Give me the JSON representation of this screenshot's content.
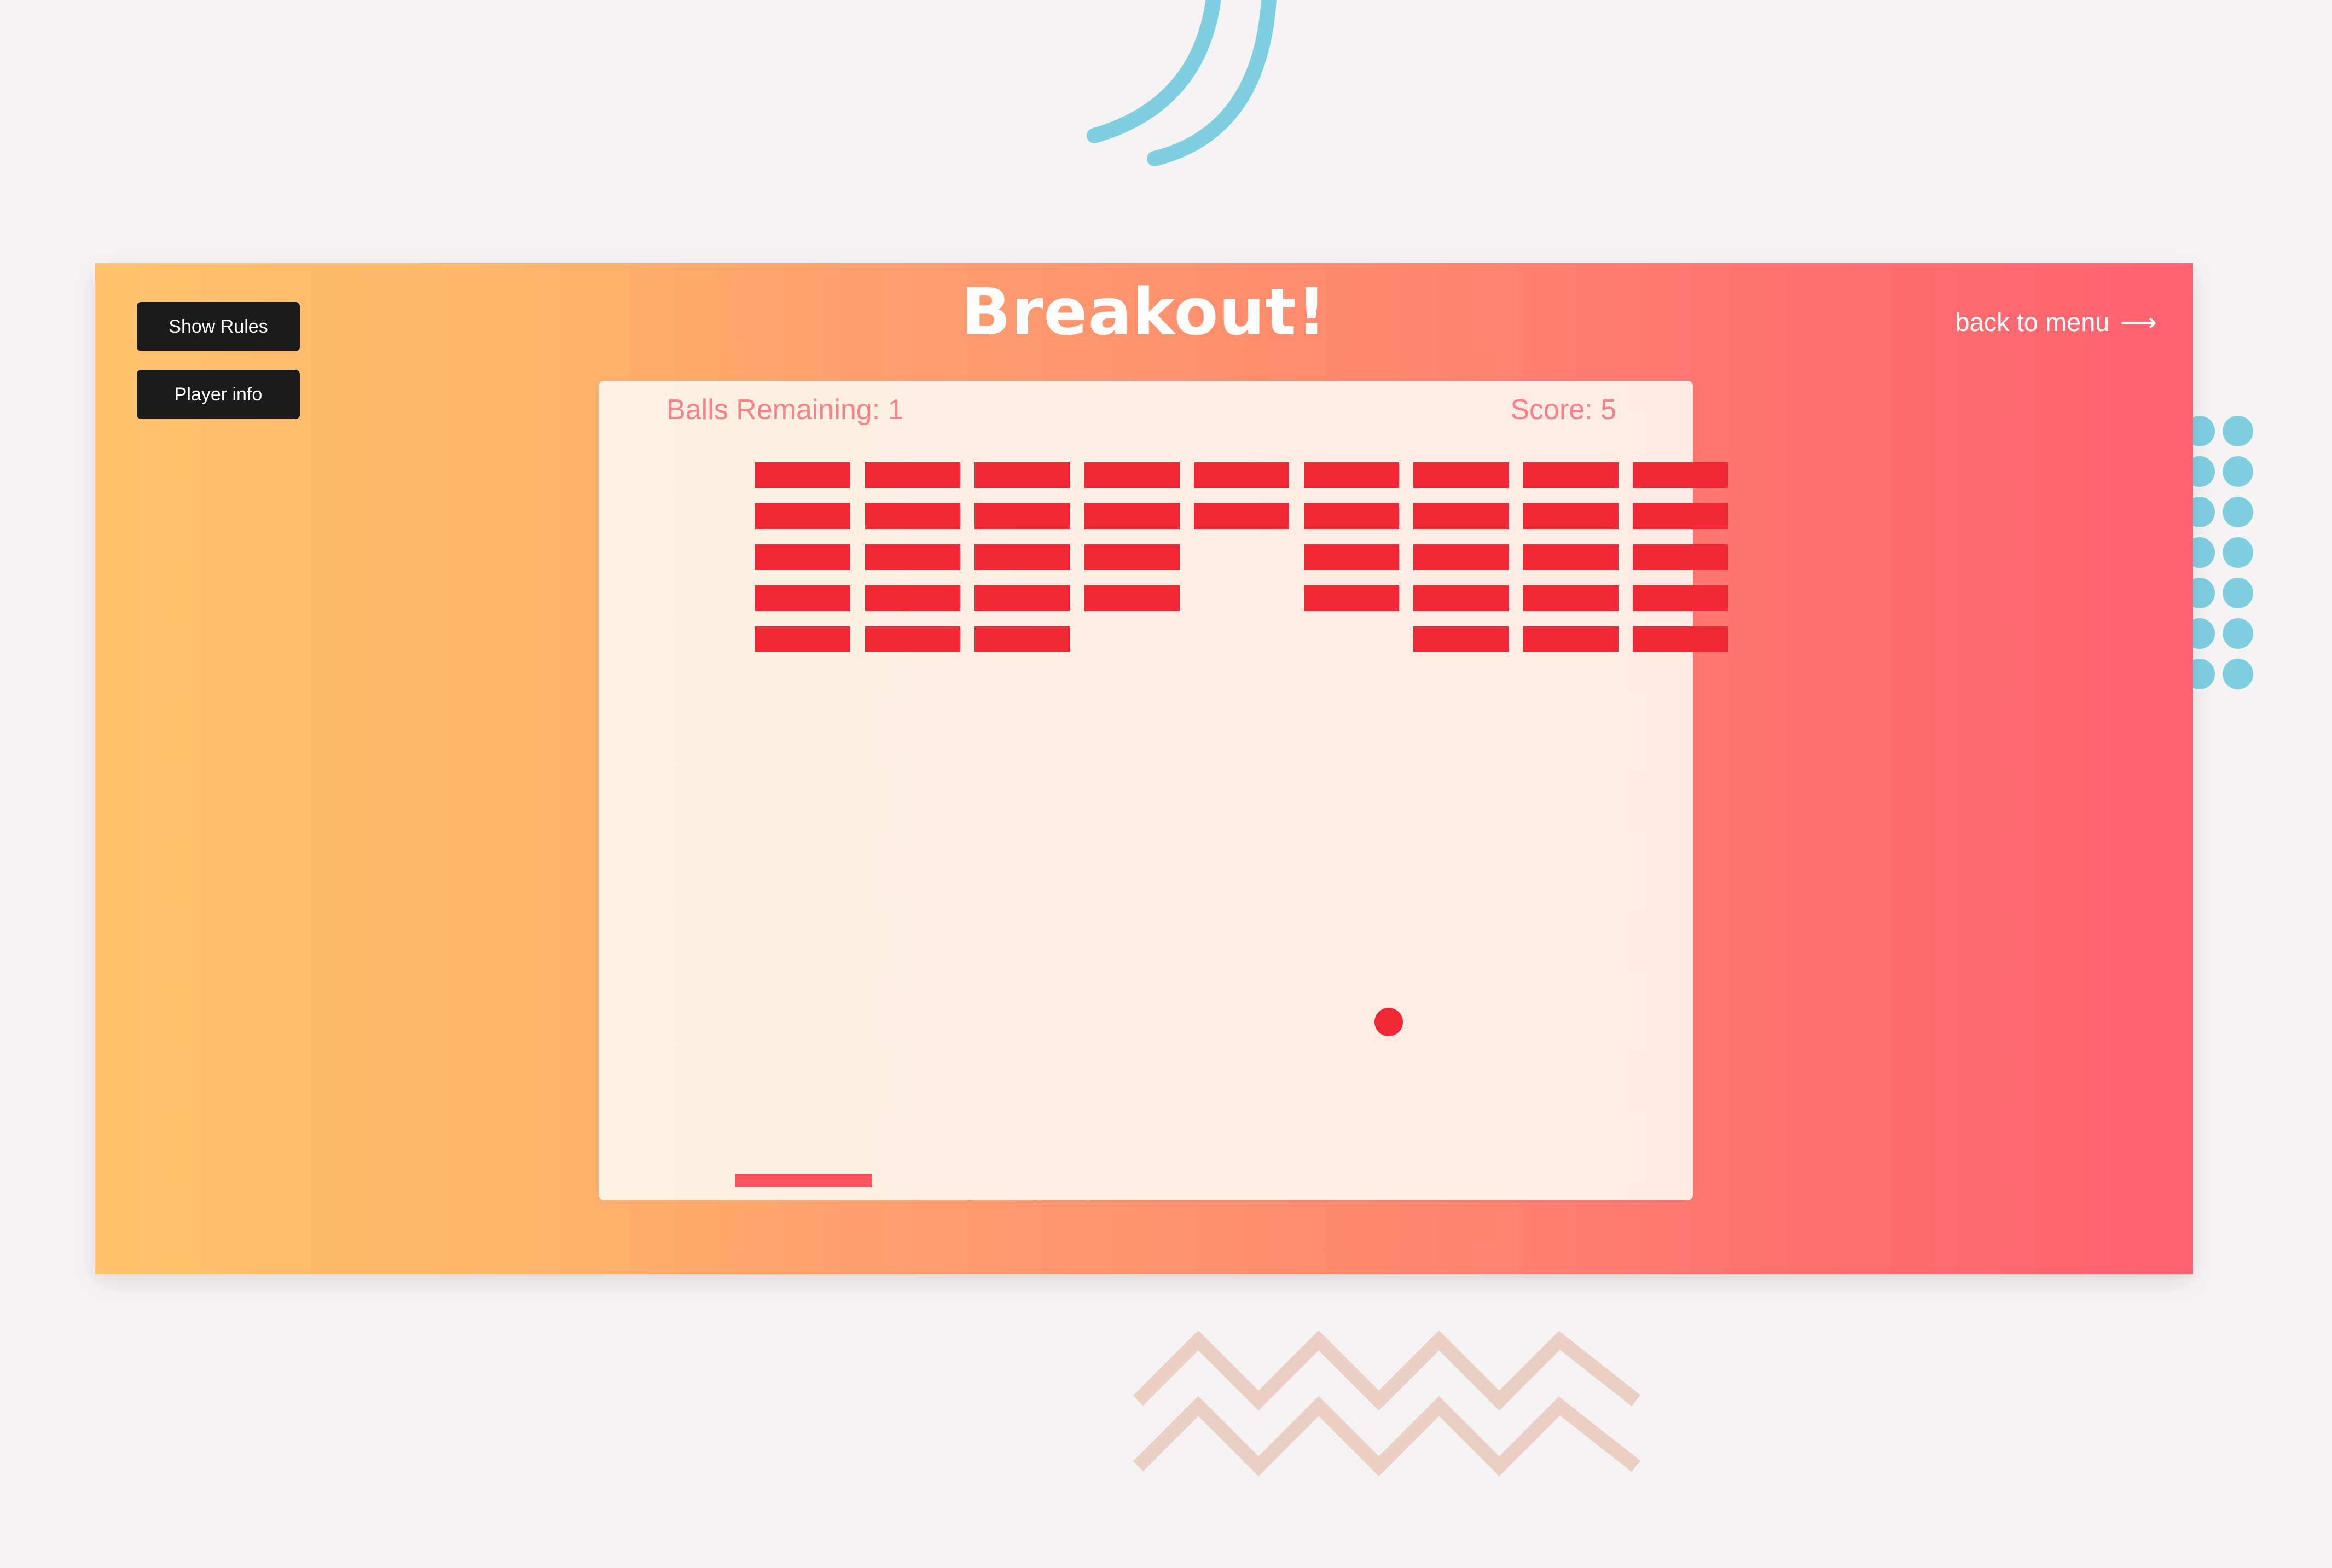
{
  "page": {
    "title": "Breakout!",
    "back_link": "back to menu",
    "back_arrow": "⟶"
  },
  "buttons": {
    "show_rules": "Show Rules",
    "player_info": "Player info"
  },
  "hud": {
    "balls_remaining": "Balls Remaining: 1",
    "score": "Score: 5"
  },
  "colors": {
    "background": "#f5f3f3",
    "panel_gradient": [
      "#ffc36d",
      "#ff6170"
    ],
    "brick": "#f22837",
    "ball": "#f22837",
    "paddle": "#ff5460",
    "hud_text": "#ff7f88",
    "button": "#1b1b1b",
    "decor_blue": "#7fcfe1",
    "decor_zigzag": "#ebcfc3"
  },
  "board": {
    "columns": 9,
    "rows": 5,
    "bricks": [
      [
        1,
        1,
        1,
        1,
        1,
        1,
        1,
        1,
        1
      ],
      [
        1,
        1,
        1,
        1,
        1,
        1,
        1,
        1,
        1
      ],
      [
        1,
        1,
        1,
        1,
        0,
        1,
        1,
        1,
        1
      ],
      [
        1,
        1,
        1,
        1,
        0,
        1,
        1,
        1,
        1
      ],
      [
        1,
        1,
        1,
        0,
        0,
        0,
        1,
        1,
        1
      ]
    ]
  },
  "icons": [
    "arc-decoration-icon",
    "dot-grid-decoration-icon",
    "zigzag-decoration-icon",
    "arrow-right-icon"
  ]
}
